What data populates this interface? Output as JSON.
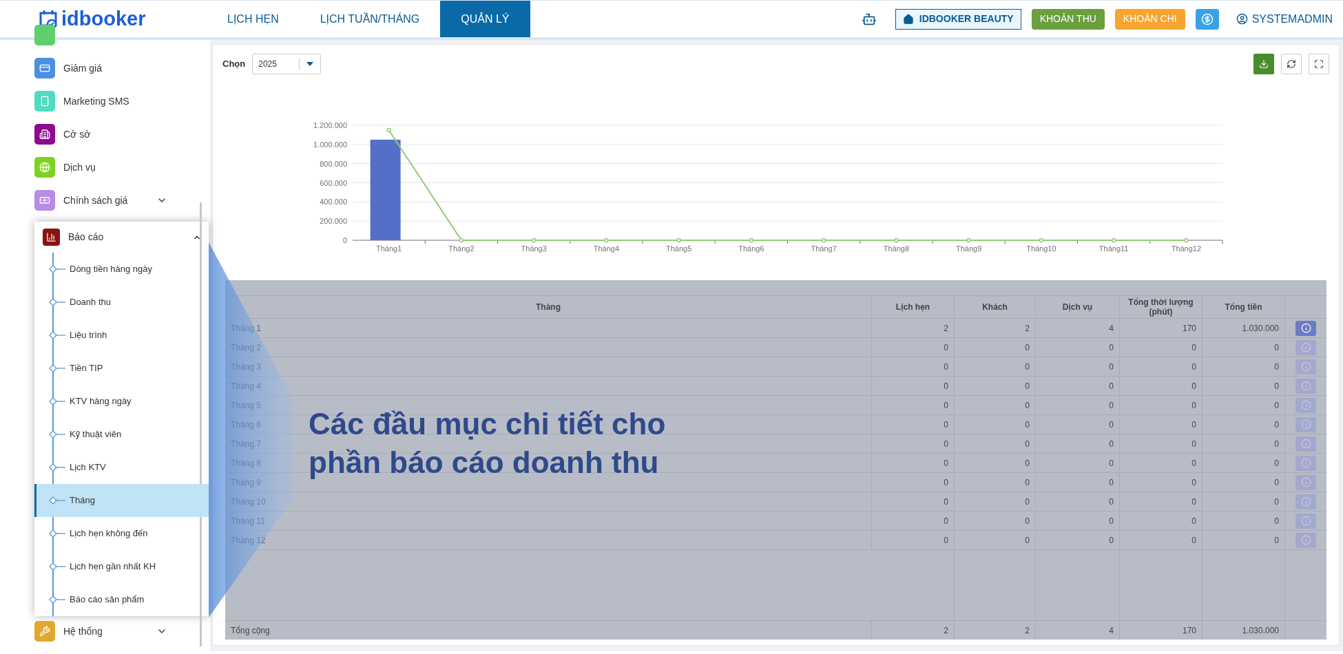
{
  "logo": {
    "text": "idbooker"
  },
  "nav": [
    {
      "label": "LỊCH HẸN",
      "selected": false
    },
    {
      "label": "LỊCH TUẦN/THÁNG",
      "selected": false
    },
    {
      "label": "QUẢN LÝ",
      "selected": true
    }
  ],
  "header_actions": {
    "branch": "IDBOOKER BEAUTY",
    "income": "KHOẢN THU",
    "expense": "KHOẢN CHI",
    "user": "SYSTEMADMIN"
  },
  "sidebar": {
    "items": [
      {
        "label": "Giảm giá",
        "color": "#4a90e2"
      },
      {
        "label": "Marketing SMS",
        "color": "#4fdcc0"
      },
      {
        "label": "Cở sở",
        "color": "#8e0a8e"
      },
      {
        "label": "Dịch vụ",
        "color": "#7ed321"
      },
      {
        "label": "Chính sách giá",
        "color": "#b98ae6",
        "expanded": false
      }
    ],
    "report": {
      "label": "Báo cáo",
      "color": "#8b1212",
      "expanded": true,
      "children": [
        {
          "label": "Dòng tiền hàng ngày",
          "selected": false
        },
        {
          "label": "Doanh thu",
          "selected": false
        },
        {
          "label": "Liệu trình",
          "selected": false
        },
        {
          "label": "Tiền TIP",
          "selected": false
        },
        {
          "label": "KTV hàng ngày",
          "selected": false
        },
        {
          "label": "Kỹ thuật viên",
          "selected": false
        },
        {
          "label": "Lịch KTV",
          "selected": false
        },
        {
          "label": "Tháng",
          "selected": true
        },
        {
          "label": "Lịch hẹn không đến",
          "selected": false
        },
        {
          "label": "Lịch hẹn gần nhất KH",
          "selected": false
        },
        {
          "label": "Báo cáo sản phẩm",
          "selected": false
        }
      ]
    },
    "bottom": {
      "label": "Hệ thống",
      "color": "#e0a82e",
      "expanded": false
    }
  },
  "filter": {
    "label": "Chọn",
    "value": "2025"
  },
  "chart_data": {
    "type": "bar",
    "grid": true,
    "categories": [
      "Tháng1",
      "Tháng2",
      "Tháng3",
      "Tháng4",
      "Tháng5",
      "Tháng6",
      "Tháng7",
      "Tháng8",
      "Tháng9",
      "Tháng10",
      "Tháng11",
      "Tháng12"
    ],
    "series": [
      {
        "type": "bar",
        "color": "#5470c6",
        "values": [
          1050000,
          0,
          0,
          0,
          0,
          0,
          0,
          0,
          0,
          0,
          0,
          0
        ]
      },
      {
        "type": "line",
        "marker": true,
        "color": "#91cc75",
        "values": [
          1150000,
          0,
          0,
          0,
          0,
          0,
          0,
          0,
          0,
          0,
          0,
          0
        ]
      }
    ],
    "ylim": [
      0,
      1200000
    ],
    "yticks": [
      {
        "value": 0,
        "label": "0"
      },
      {
        "value": 200000,
        "label": "200.000"
      },
      {
        "value": 400000,
        "label": "400.000"
      },
      {
        "value": 600000,
        "label": "600.000"
      },
      {
        "value": 800000,
        "label": "800.000"
      },
      {
        "value": 1000000,
        "label": "1.000.000"
      },
      {
        "value": 1200000,
        "label": "1.200.000"
      }
    ]
  },
  "table": {
    "columns": [
      "Tháng",
      "Lịch hẹn",
      "Khách",
      "Dịch vụ",
      "Tổng thời lượng (phút)",
      "Tổng tiền"
    ],
    "rows": [
      {
        "cells": [
          "Tháng 1",
          "2",
          "2",
          "4",
          "170",
          "1.030.000"
        ],
        "disabled": false
      },
      {
        "cells": [
          "Tháng 2",
          "0",
          "0",
          "0",
          "0",
          "0"
        ],
        "disabled": true
      },
      {
        "cells": [
          "Tháng 3",
          "0",
          "0",
          "0",
          "0",
          "0"
        ],
        "disabled": true
      },
      {
        "cells": [
          "Tháng 4",
          "0",
          "0",
          "0",
          "0",
          "0"
        ],
        "disabled": true
      },
      {
        "cells": [
          "Tháng 5",
          "0",
          "0",
          "0",
          "0",
          "0"
        ],
        "disabled": true
      },
      {
        "cells": [
          "Tháng 6",
          "0",
          "0",
          "0",
          "0",
          "0"
        ],
        "disabled": true
      },
      {
        "cells": [
          "Tháng 7",
          "0",
          "0",
          "0",
          "0",
          "0"
        ],
        "disabled": true
      },
      {
        "cells": [
          "Tháng 8",
          "0",
          "0",
          "0",
          "0",
          "0"
        ],
        "disabled": true
      },
      {
        "cells": [
          "Tháng 9",
          "0",
          "0",
          "0",
          "0",
          "0"
        ],
        "disabled": true
      },
      {
        "cells": [
          "Tháng 10",
          "0",
          "0",
          "0",
          "0",
          "0"
        ],
        "disabled": true
      },
      {
        "cells": [
          "Tháng 11",
          "0",
          "0",
          "0",
          "0",
          "0"
        ],
        "disabled": true
      },
      {
        "cells": [
          "Tháng 12",
          "0",
          "0",
          "0",
          "0",
          "0"
        ],
        "disabled": true
      }
    ],
    "total": [
      "Tổng cộng",
      "2",
      "2",
      "4",
      "170",
      "1.030.000"
    ]
  },
  "callout": {
    "lines": [
      "Các đầu mục chi tiết cho",
      "phần báo cáo doanh thu"
    ]
  }
}
